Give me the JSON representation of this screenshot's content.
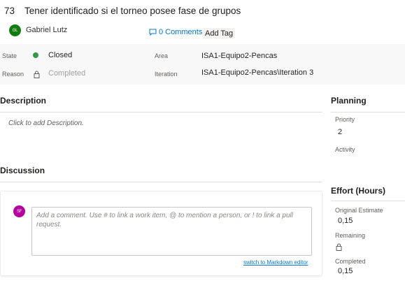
{
  "work_item": {
    "id": "73",
    "title": "Tener identificado si el torneo posee fase de grupos",
    "author": {
      "initials": "GL",
      "name": "Gabriel Lutz",
      "avatar_color": "#107c10"
    }
  },
  "header_actions": {
    "comments_label": "0 Comments",
    "add_tag_label": "Add Tag"
  },
  "fields": {
    "state_label": "State",
    "state_value": "Closed",
    "state_color": "#339947",
    "reason_label": "Reason",
    "reason_value": "Completed",
    "area_label": "Area",
    "area_value": "ISA1-Equipo2-Pencas",
    "iteration_label": "Iteration",
    "iteration_value": "ISA1-Equipo2-Pencas\\Iteration 3"
  },
  "description": {
    "heading": "Description",
    "placeholder": "Click to add Description."
  },
  "discussion": {
    "heading": "Discussion",
    "user_initials": "SF",
    "user_avatar_color": "#b4009e",
    "comment_placeholder": "Add a comment. Use # to link a work item, @ to mention a person, or ! to link a pull request.",
    "markdown_link": "switch to Markdown editor"
  },
  "planning": {
    "heading": "Planning",
    "priority_label": "Priority",
    "priority_value": "2",
    "activity_label": "Activity"
  },
  "effort": {
    "heading": "Effort (Hours)",
    "original_estimate_label": "Original Estimate",
    "original_estimate_value": "0,15",
    "remaining_label": "Remaining",
    "completed_label": "Completed",
    "completed_value": "0,15"
  },
  "colors": {
    "link": "#0078d4"
  }
}
